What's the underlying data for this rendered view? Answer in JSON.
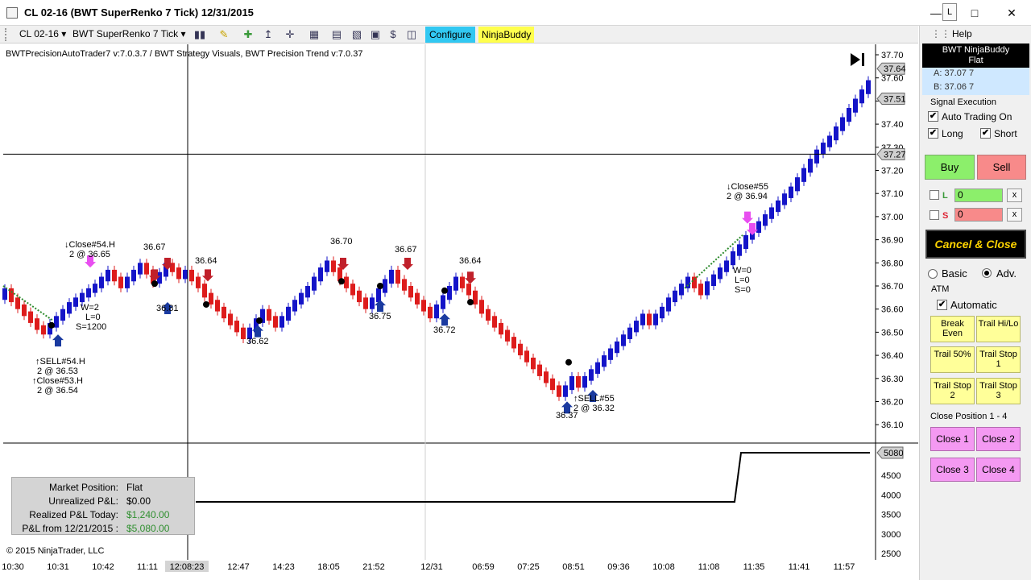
{
  "window": {
    "title": "CL 02-16 (BWT SuperRenko  7 Tick)  12/31/2015",
    "pin_label": "L"
  },
  "toolbar": {
    "instrument": "CL 02-16",
    "bar_type": "BWT SuperRenko  7 Tick",
    "configure_label": "Configure",
    "ninjabuddy_label": "NinjaBuddy"
  },
  "chart": {
    "strategy_label": "BWTPrecisionAutoTrader7 v:7.0.3.7 / BWT Strategy Visuals, BWT Precision Trend v:7.0.37",
    "copyright": "© 2015 NinjaTrader, LLC",
    "colors": {
      "up_bar": "#1414c8",
      "down_bar": "#dd1c1c",
      "trend_line": "#2e8b2e"
    },
    "price_axis": [
      "37.70",
      "37.60",
      "37.50",
      "37.40",
      "37.30",
      "37.20",
      "37.10",
      "37.00",
      "36.90",
      "36.80",
      "36.70",
      "36.60",
      "36.50",
      "36.40",
      "36.30",
      "36.20",
      "36.10"
    ],
    "price_tags": {
      "ask": "37.64",
      "bid": "37.51",
      "crosshair": "37.27"
    },
    "pnl_axis": [
      "4500",
      "4000",
      "3500",
      "3000",
      "2500"
    ],
    "pnl_tag": "5080",
    "time_axis": [
      "10:30",
      "10:31",
      "10:42",
      "11:11",
      "12:08:23",
      "12:47",
      "14:23",
      "18:05",
      "21:52",
      "12/31",
      "06:59",
      "07:25",
      "08:51",
      "09:36",
      "10:08",
      "11:08",
      "11:35",
      "11:41",
      "11:57"
    ],
    "annotations": [
      "↓Close#54.H",
      "2 @ 36.65",
      "36.67",
      "36.81",
      "36.64",
      "W=2",
      "L=0",
      "S=1200",
      "↑SELL#54.H",
      "2 @ 36.53",
      "↑Close#53.H",
      "2 @ 36.54",
      "36.62",
      "36.70",
      "36.75",
      "36.67",
      "36.72",
      "36.64",
      "↑SELL#55",
      "2 @ 36.32",
      "36.37",
      "↓Close#55",
      "2 @ 36.94",
      "W=0",
      "L=0",
      "S=0"
    ],
    "pnl_box": {
      "rows": [
        {
          "label": "Market Position:",
          "value": "Flat"
        },
        {
          "label": "Unrealized P&L:",
          "value": "$0.00"
        },
        {
          "label": "Realized P&L Today:",
          "value": "$1,240.00"
        },
        {
          "label": "P&L from 12/21/2015 :",
          "value": "$5,080.00"
        }
      ]
    }
  },
  "panel": {
    "help_label": "Help",
    "instrument_title": "BWT NinjaBuddy",
    "position_status": "Flat",
    "ask_line": "A: 37.07 7",
    "bid_line": "B: 37.06 7",
    "signal_execution_label": "Signal Execution",
    "auto_trading_label": "Auto Trading On",
    "long_label": "Long",
    "short_label": "Short",
    "buy_label": "Buy",
    "sell_label": "Sell",
    "long_qty_label": "L",
    "long_qty_value": "0",
    "short_qty_label": "S",
    "short_qty_value": "0",
    "clear_label": "x",
    "cancel_close_label": "Cancel & Close",
    "basic_label": "Basic",
    "adv_label": "Adv.",
    "atm_label": "ATM",
    "automatic_label": "Automatic",
    "atm_buttons": [
      "Break Even",
      "Trail Hi/Lo",
      "Trail 50%",
      "Trail Stop 1",
      "Trail Stop 2",
      "Trail Stop 3"
    ],
    "close_position_label": "Close Position 1 - 4",
    "close_buttons": [
      "Close 1",
      "Close 2",
      "Close 3",
      "Close 4"
    ],
    "check_mark": "✔"
  }
}
